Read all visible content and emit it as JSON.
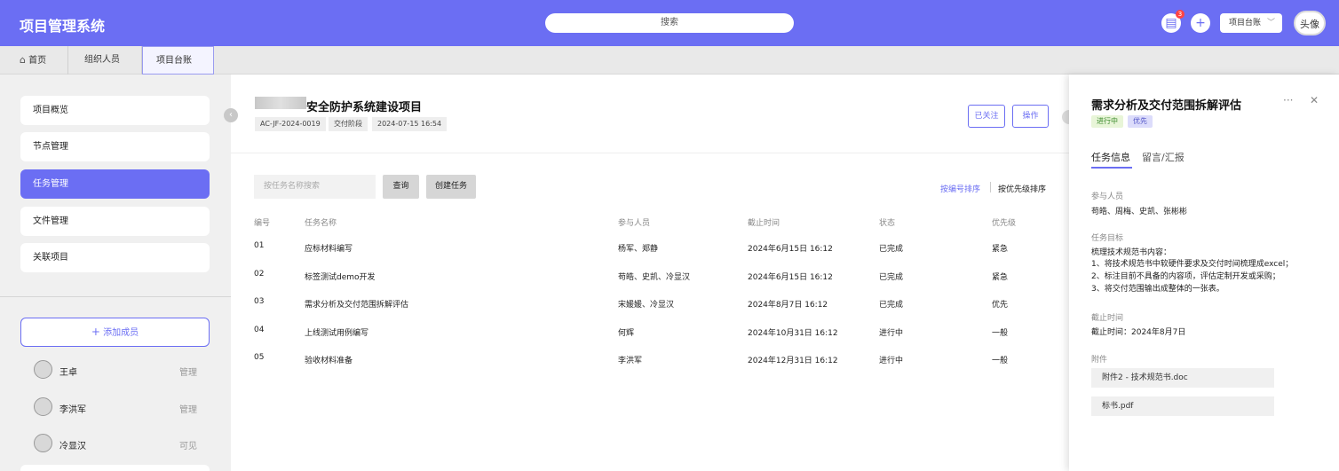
{
  "header": {
    "app_title": "项目管理系统",
    "search_placeholder": "搜索",
    "message_badge": "3",
    "project_select": "项目台账",
    "avatar_text": "头像"
  },
  "tabs": [
    {
      "label": "首页"
    },
    {
      "label": "组织人员"
    },
    {
      "label": "项目台账"
    }
  ],
  "sidebar": {
    "nav": [
      {
        "label": "项目概览"
      },
      {
        "label": "节点管理"
      },
      {
        "label": "任务管理"
      },
      {
        "label": "文件管理"
      },
      {
        "label": "关联项目"
      }
    ],
    "add_member_label": "添加成员",
    "members": [
      {
        "name": "王卓",
        "role": "管理"
      },
      {
        "name": "李洪军",
        "role": "管理"
      },
      {
        "name": "冷显汉",
        "role": "可见"
      }
    ]
  },
  "project": {
    "title": "安全防护系统建设项目",
    "code": "AC-JF-2024-0019",
    "phase": "交付阶段",
    "datetime": "2024-07-15  16:54",
    "follow_label": "已关注",
    "action_label": "操作"
  },
  "task_toolbar": {
    "search_placeholder": "按任务名称搜索",
    "query_label": "查询",
    "create_label": "创建任务",
    "sort_by_number": "按编号排序",
    "sort_by_priority": "按优先级排序"
  },
  "task_table": {
    "headers": [
      "编号",
      "任务名称",
      "参与人员",
      "截止时间",
      "状态",
      "优先级"
    ],
    "rows": [
      {
        "id": "01",
        "name": "应标材料编写",
        "members": "杨军、郑静",
        "deadline": "2024年6月15日 16:12",
        "status": "已完成",
        "priority": "紧急"
      },
      {
        "id": "02",
        "name": "标签测试demo开发",
        "members": "苟皓、史凯、冷显汉",
        "deadline": "2024年6月15日 16:12",
        "status": "已完成",
        "priority": "紧急"
      },
      {
        "id": "03",
        "name": "需求分析及交付范围拆解评估",
        "members": "宋媛媛、冷显汉",
        "deadline": "2024年8月7日 16:12",
        "status": "已完成",
        "priority": "优先"
      },
      {
        "id": "04",
        "name": "上线测试用例编写",
        "members": "何辉",
        "deadline": "2024年10月31日 16:12",
        "status": "进行中",
        "priority": "一般"
      },
      {
        "id": "05",
        "name": "验收材料准备",
        "members": "李洪军",
        "deadline": "2024年12月31日 16:12",
        "status": "进行中",
        "priority": "一般"
      }
    ]
  },
  "detail_panel": {
    "title": "需求分析及交付范围拆解评估",
    "status_tag": "进行中",
    "priority_tag": "优先",
    "tab_info": "任务信息",
    "tab_comments": "留言/汇报",
    "participants_label": "参与人员",
    "participants": "苟皓、周梅、史凯、张彬彬",
    "goal_label": "任务目标",
    "goal_lines": [
      "梳理技术规范书内容：",
      "1、将技术规范书中软硬件要求及交付时间梳理成excel；",
      "2、标注目前不具备的内容项，评估定制开发或采购；",
      "3、将交付范围输出成整体的一张表。"
    ],
    "deadline_label": "截止时间",
    "deadline_value": "截止时间：2024年8月7日",
    "attachments_label": "附件",
    "attachments": [
      "附件2 - 技术规范书.doc",
      "标书.pdf"
    ]
  },
  "colors": {
    "primary": "#6b6ef3",
    "status_in_progress_bg": "#e8f5d8",
    "priority_bg": "#dcdcfb"
  }
}
